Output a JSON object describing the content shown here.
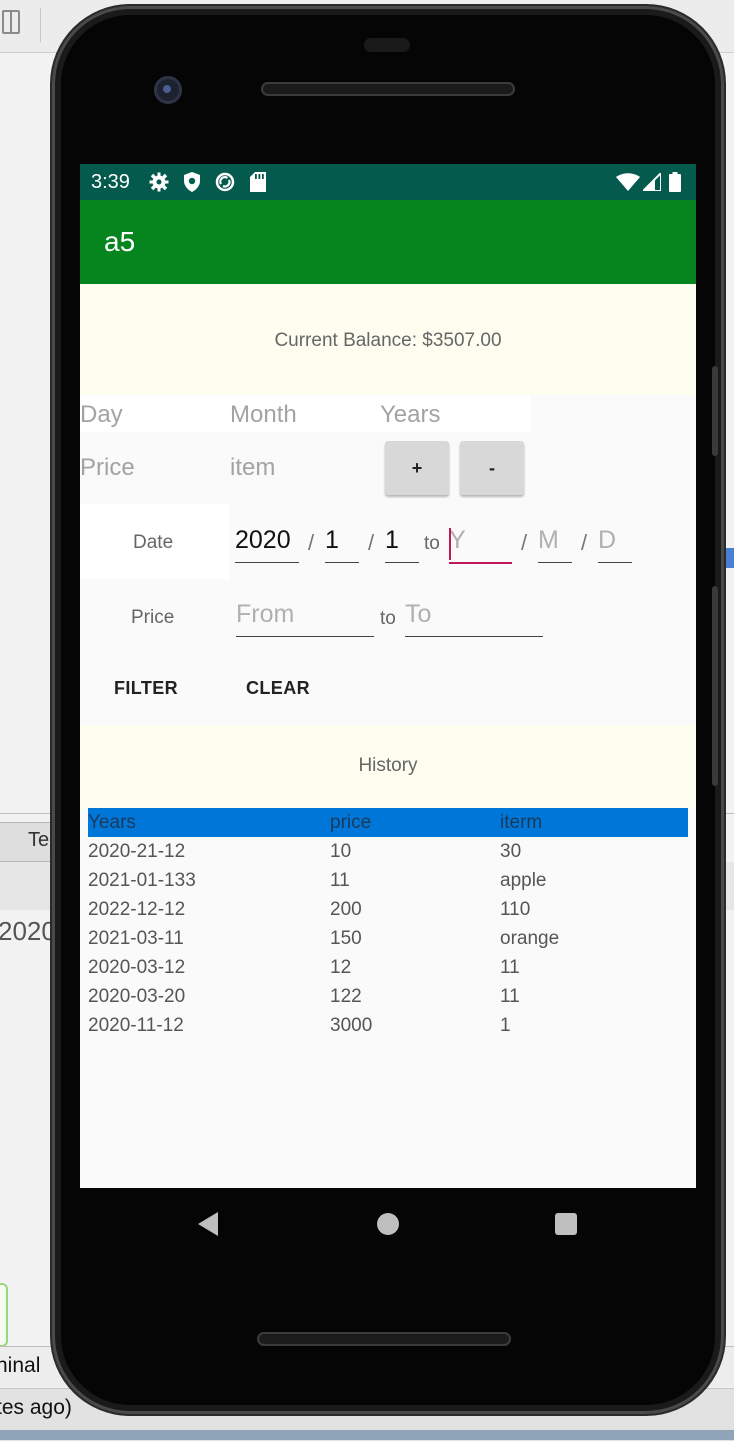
{
  "ide": {
    "tab_label": "Te",
    "side_year": "2020",
    "terminal_label": "ninal",
    "status_text": "tes ago)"
  },
  "status_bar": {
    "time": "3:39",
    "icons": [
      "gear-icon",
      "shield-icon",
      "sync-icon",
      "sd-card-icon",
      "wifi-icon",
      "signal-icon",
      "battery-icon"
    ]
  },
  "app": {
    "title": "a5",
    "header_color": "#06841e",
    "status_color": "#045a4c"
  },
  "balance": {
    "text": "Current Balance: $3507.00"
  },
  "entry_form": {
    "day_placeholder": "Day",
    "month_placeholder": "Month",
    "years_placeholder": "Years",
    "price_placeholder": "Price",
    "item_placeholder": "item",
    "add_label": "+",
    "subtract_label": "-"
  },
  "filter": {
    "date_label": "Date",
    "from_year": "2020",
    "from_month": "1",
    "from_day": "1",
    "to_word": "to",
    "to_year_placeholder": "Y",
    "to_month_placeholder": "M",
    "to_day_placeholder": "D",
    "slash": "/",
    "price_label": "Price",
    "price_from_placeholder": "From",
    "price_to_placeholder": "To",
    "filter_label": "FILTER",
    "clear_label": "CLEAR"
  },
  "history": {
    "title": "History",
    "columns": [
      "Years",
      "price",
      "iterm"
    ],
    "header_color": "#0176d9",
    "rows": [
      [
        "2020-21-12",
        "10",
        "30"
      ],
      [
        "2021-01-133",
        "11",
        "apple"
      ],
      [
        "2022-12-12",
        "200",
        "110"
      ],
      [
        "2021-03-11",
        "150",
        "orange"
      ],
      [
        "2020-03-12",
        "12",
        "11"
      ],
      [
        "2020-03-20",
        "122",
        "11"
      ],
      [
        "2020-11-12",
        "3000",
        "1"
      ]
    ]
  },
  "nav": {
    "icons": [
      "back-icon",
      "home-icon",
      "recents-icon"
    ]
  }
}
